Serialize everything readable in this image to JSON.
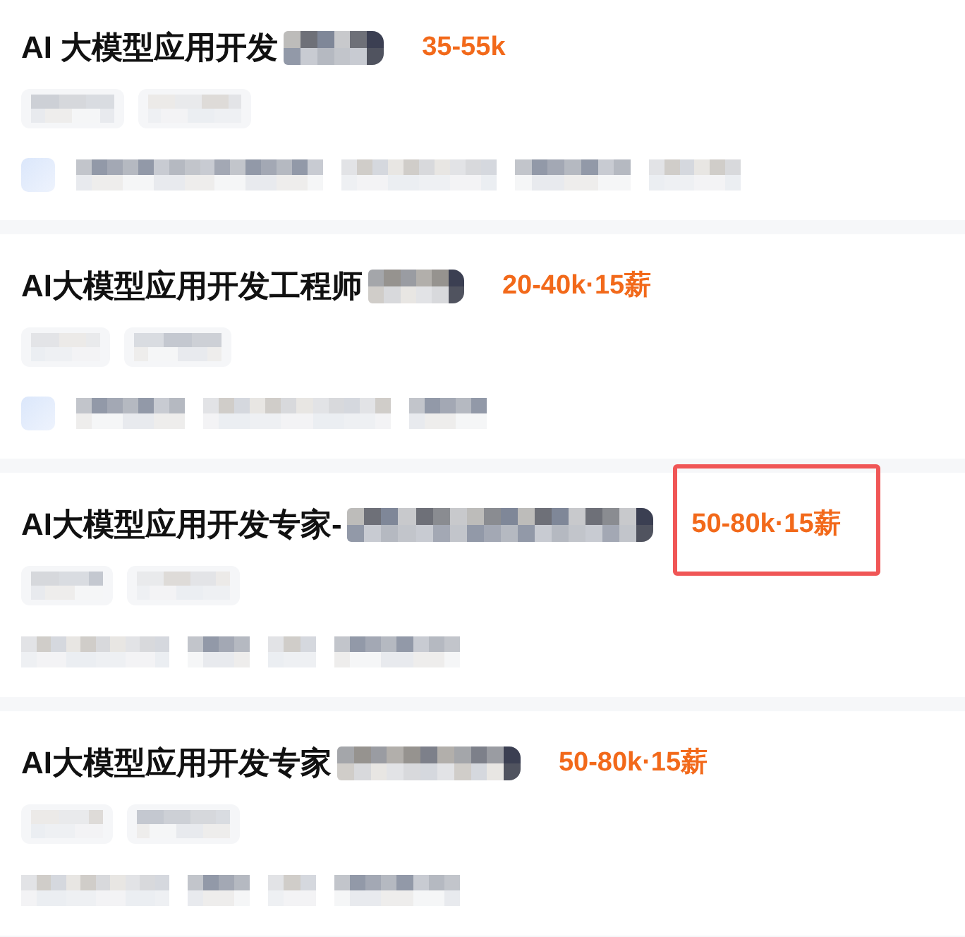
{
  "jobs": [
    {
      "title": "AI 大模型应用开发",
      "title_redacted": true,
      "salary": "35-55k",
      "salary_highlighted": false,
      "tags": [
        {
          "kind": "blurred"
        },
        {
          "kind": "blurred"
        }
      ],
      "details": [
        {
          "kind": "logo"
        },
        {
          "kind": "blurred"
        },
        {
          "kind": "blurred"
        },
        {
          "kind": "blurred"
        },
        {
          "kind": "blurred"
        }
      ]
    },
    {
      "title": "AI大模型应用开发工程师",
      "title_redacted": true,
      "salary": "20-40k·15薪",
      "salary_highlighted": false,
      "tags": [
        {
          "kind": "blurred"
        },
        {
          "kind": "blurred"
        }
      ],
      "details": [
        {
          "kind": "logo"
        },
        {
          "kind": "blurred"
        },
        {
          "kind": "blurred"
        },
        {
          "kind": "blurred"
        }
      ]
    },
    {
      "title": "AI大模型应用开发专家-",
      "title_redacted": true,
      "salary": "50-80k·15薪",
      "salary_highlighted": true,
      "tags": [
        {
          "kind": "blurred"
        },
        {
          "kind": "blurred"
        }
      ],
      "details": [
        {
          "kind": "blurred"
        },
        {
          "kind": "blurred"
        },
        {
          "kind": "blurred"
        },
        {
          "kind": "blurred"
        }
      ]
    },
    {
      "title": "AI大模型应用开发专家",
      "title_redacted": true,
      "salary": "50-80k·15薪",
      "salary_highlighted": false,
      "tags": [
        {
          "kind": "blurred"
        },
        {
          "kind": "blurred"
        }
      ],
      "details": [
        {
          "kind": "blurred"
        },
        {
          "kind": "blurred"
        },
        {
          "kind": "blurred"
        },
        {
          "kind": "blurred"
        }
      ]
    }
  ]
}
